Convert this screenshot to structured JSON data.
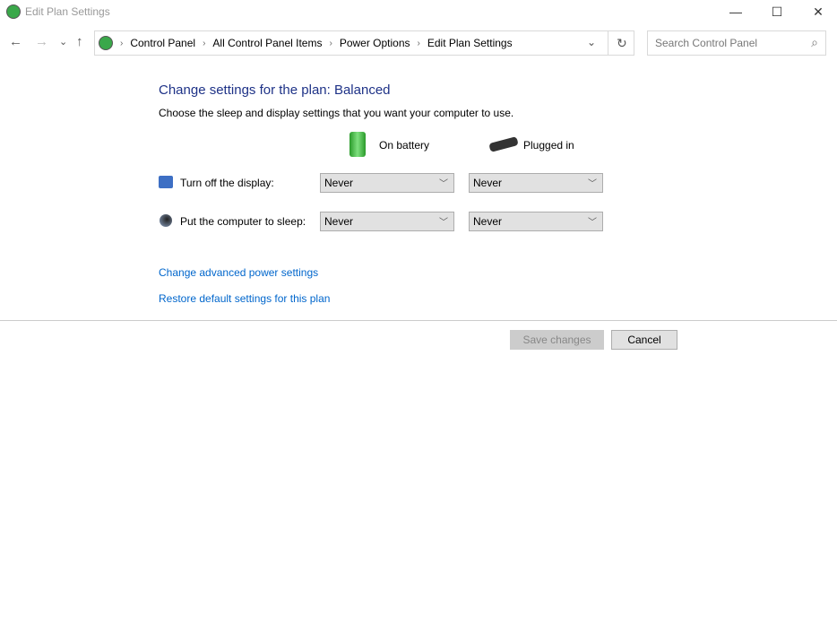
{
  "window": {
    "title": "Edit Plan Settings",
    "minimize": "—",
    "maximize": "☐",
    "close": "✕"
  },
  "nav": {
    "back": "←",
    "forward": "→",
    "recent": "⌄",
    "up": "↑",
    "refresh": "↻",
    "dropdown": "⌄"
  },
  "breadcrumb": [
    "Control Panel",
    "All Control Panel Items",
    "Power Options",
    "Edit Plan Settings"
  ],
  "search": {
    "placeholder": "Search Control Panel",
    "icon": "⌕"
  },
  "main": {
    "heading": "Change settings for the plan: Balanced",
    "subheading": "Choose the sleep and display settings that you want your computer to use.",
    "columns": [
      "On battery",
      "Plugged in"
    ],
    "settings": [
      {
        "label": "Turn off the display:",
        "battery": "Never",
        "plugged": "Never"
      },
      {
        "label": "Put the computer to sleep:",
        "battery": "Never",
        "plugged": "Never"
      }
    ],
    "links": [
      "Change advanced power settings",
      "Restore default settings for this plan"
    ],
    "save": "Save changes",
    "cancel": "Cancel"
  }
}
